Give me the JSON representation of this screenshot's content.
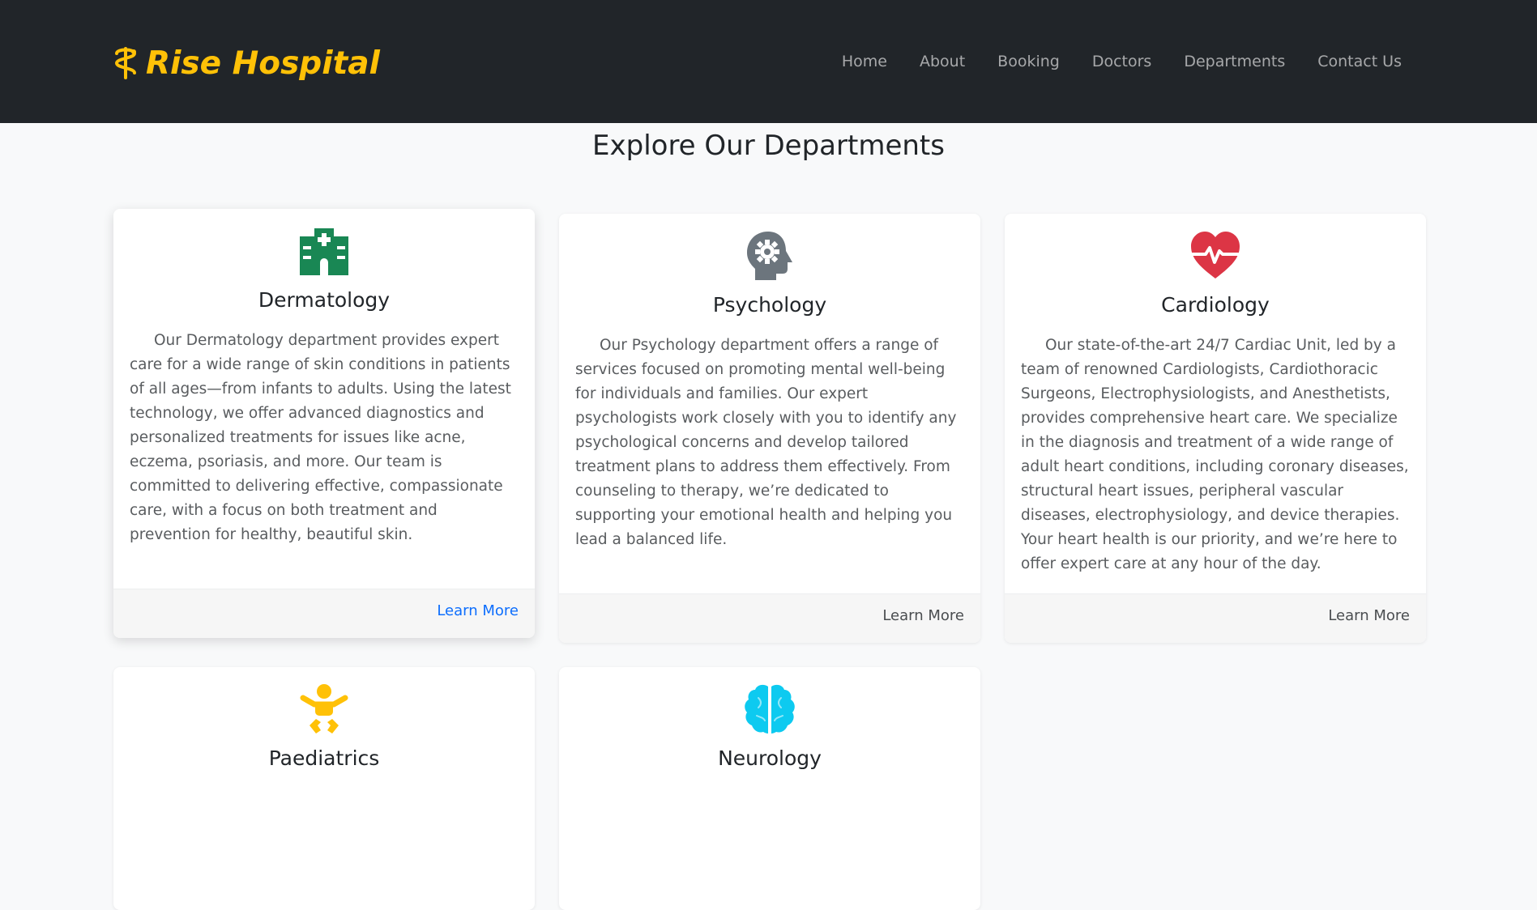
{
  "brand": {
    "name": "Rise Hospital",
    "icon": "staff-of-hermes-icon",
    "color": "#ffc107"
  },
  "nav": {
    "items": [
      "Home",
      "About",
      "Booking",
      "Doctors",
      "Departments",
      "Contact Us"
    ]
  },
  "page": {
    "title": "Explore Our Departments"
  },
  "departments": [
    {
      "name": "Dermatology",
      "icon": "hospital-icon",
      "icon_color": "#198754",
      "description": "Our Dermatology department provides expert care for a wide range of skin conditions in patients of all ages—from infants to adults. Using the latest technology, we offer advanced diagnostics and personalized treatments for issues like acne, eczema, psoriasis, and more. Our team is committed to delivering effective, compassionate care, with a focus on both treatment and prevention for healthy, beautiful skin.",
      "link": "Learn More"
    },
    {
      "name": "Psychology",
      "icon": "head-gear-icon",
      "icon_color": "#6c757d",
      "description": "Our Psychology department offers a range of services focused on promoting mental well-being for individuals and families. Our expert psychologists work closely with you to identify any psychological concerns and develop tailored treatment plans to address them effectively. From counseling to therapy, we’re dedicated to supporting your emotional health and helping you lead a balanced life.",
      "link": "Learn More"
    },
    {
      "name": "Cardiology",
      "icon": "heart-pulse-icon",
      "icon_color": "#dc3545",
      "description": "Our state-of-the-art 24/7 Cardiac Unit, led by a team of renowned Cardiologists, Cardiothoracic Surgeons, Electrophysiologists, and Anesthetists, provides comprehensive heart care. We specialize in the diagnosis and treatment of a wide range of adult heart conditions, including coronary diseases, structural heart issues, peripheral vascular diseases, electrophysiology, and device therapies. Your heart health is our priority, and we’re here to offer expert care at any hour of the day.",
      "link": "Learn More"
    },
    {
      "name": "Paediatrics",
      "icon": "baby-icon",
      "icon_color": "#ffc107"
    },
    {
      "name": "Neurology",
      "icon": "brain-icon",
      "icon_color": "#0dcaf0"
    }
  ],
  "link_hover_color": "#0d6efd"
}
